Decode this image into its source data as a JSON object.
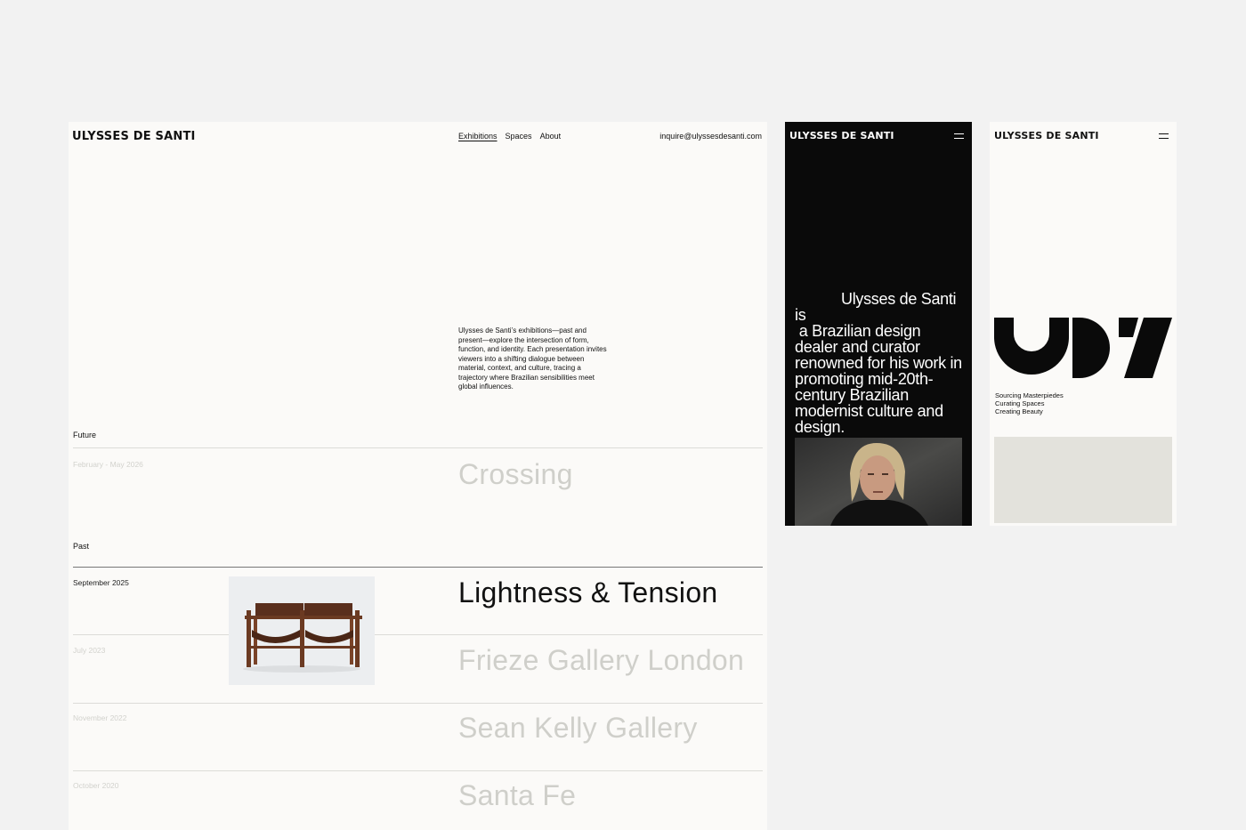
{
  "desktop": {
    "brand": "ULYSSES DE SANTI",
    "nav": [
      "Exhibitions",
      "Spaces",
      "About"
    ],
    "email": "inquire@ulyssesdesanti.com",
    "intro": "Ulysses de Santi’s exhibitions—past and present—explore the intersection of form, function, and identity. Each presentation invites viewers into a shifting dialogue between material, context, and culture, tracing a trajectory where Brazilian sensibilities meet global influences.",
    "future_label": "Future",
    "past_label": "Past",
    "future": [
      {
        "date": "February - May 2026",
        "title": "Crossing"
      }
    ],
    "past": [
      {
        "date": "September 2025",
        "title": "Lightness & Tension"
      },
      {
        "date": "July 2023",
        "title": "Frieze Gallery London"
      },
      {
        "date": "November 2022",
        "title": "Sean Kelly Gallery"
      },
      {
        "date": "October 2020",
        "title": "Santa Fe"
      }
    ]
  },
  "mobile_dark": {
    "brand": "ULYSSES DE SANTI",
    "bio_lines": [
      "Ulysses de Santi is",
      "a Brazilian design",
      "dealer and curator",
      "renowned for his work in",
      "promoting mid-20th-",
      "century  Brazilian",
      "modernist culture and",
      "design."
    ]
  },
  "mobile_light": {
    "brand": "ULYSSES DE SANTI",
    "taglines": [
      "Sourcing Masterpiedes",
      "Curating Spaces",
      "Creating Beauty"
    ]
  }
}
